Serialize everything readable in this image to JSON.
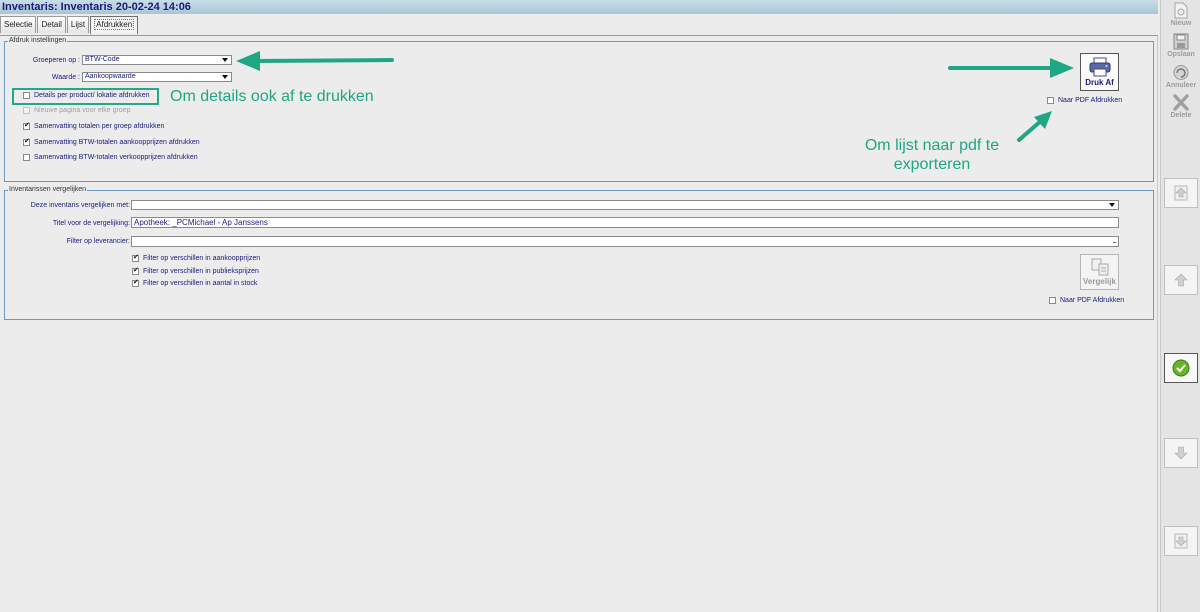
{
  "window": {
    "title": "Inventaris: Inventaris 20-02-24 14:06"
  },
  "tabs": [
    {
      "label": "Selectie"
    },
    {
      "label": "Detail"
    },
    {
      "label": "Lijst"
    },
    {
      "label": "Afdrukken"
    }
  ],
  "print_settings": {
    "legend": "Afdruk instellingen",
    "group_by_label": "Groeperen op :",
    "group_by_value": "BTW-Code",
    "value_label": "Waarde :",
    "value_value": "Aankoopwaarde",
    "checkboxes": [
      {
        "label": "Details per product/ lokatie afdrukken",
        "checked": false,
        "enabled": true
      },
      {
        "label": "Nieuwe pagina voor elke groep",
        "checked": false,
        "enabled": false
      },
      {
        "label": "Samenvatting totalen per groep afdrukken",
        "checked": true,
        "enabled": true
      },
      {
        "label": "Samenvatting BTW-totalen aankoopprijzen afdrukken",
        "checked": true,
        "enabled": true
      },
      {
        "label": "Samenvatting BTW-totalen verkoopprijzen afdrukken",
        "checked": false,
        "enabled": true
      }
    ],
    "print_button": "Druk Af",
    "pdf_label": "Naar PDF Afdrukken",
    "pdf_checked": false
  },
  "compare": {
    "legend": "Inventarissen vergelijken",
    "compare_with_label": "Deze inventaris vergelijken met:",
    "compare_with_value": "",
    "title_label": "Titel voor de vergelijking:",
    "title_value": "Apotheek: _PCMichael - Ap Janssens",
    "supplier_label": "Filter op leverancier:",
    "supplier_value": "",
    "supplier_dots": "...",
    "checkboxes": [
      {
        "label": "Filter op verschillen in aankoopprijzen",
        "checked": true
      },
      {
        "label": "Filter op verschillen in publieksprijzen",
        "checked": true
      },
      {
        "label": "Filter op verschillen in aantal in stock",
        "checked": true
      }
    ],
    "compare_button": "Vergelijk",
    "pdf_label": "Naar PDF Afdrukken",
    "pdf_checked": false
  },
  "annotations": {
    "details_note": "Om details ook af te drukken",
    "pdf_note_line1": "Om lijst naar pdf te",
    "pdf_note_line2": "exporteren"
  },
  "sidebar": {
    "new_label": "Nieuw",
    "save_label": "Opslaan",
    "cancel_label": "Annuleer",
    "delete_label": "Delete"
  },
  "colors": {
    "annotation": "#1fa683",
    "group_border": "#6c9cc4",
    "label_text": "#1a1a7e"
  }
}
